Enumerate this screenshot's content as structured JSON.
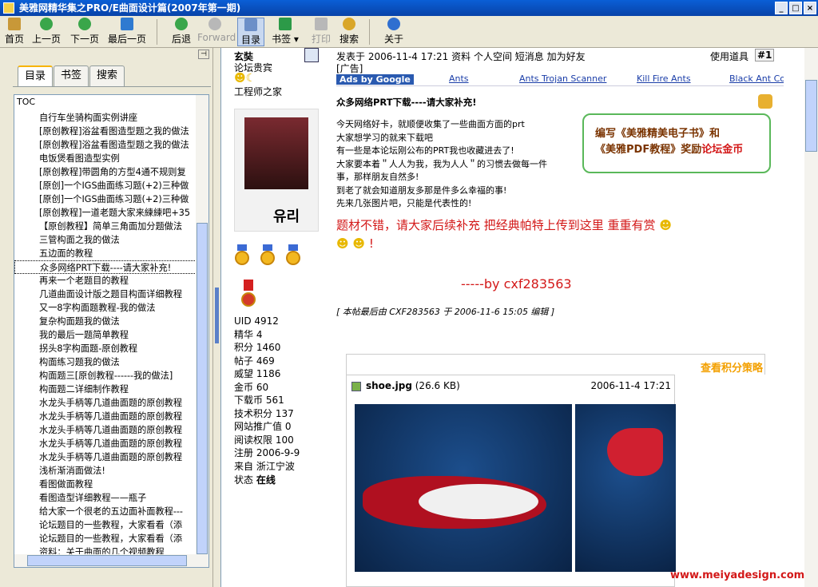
{
  "window": {
    "title": "美雅网精华集之PRO/E曲面设计篇(2007年第一期)"
  },
  "toolbar": {
    "home": "首页",
    "prev": "上一页",
    "next": "下一页",
    "last": "最后一页",
    "back": "后退",
    "forward": "Forward",
    "toc": "目录",
    "bookmark": "书签",
    "print": "打印",
    "search": "搜索",
    "about": "关于"
  },
  "left": {
    "tabs": [
      "目录",
      "书签",
      "搜索"
    ],
    "toc_header": "TOC",
    "items": [
      "自行车坐骑构面实例讲座",
      "[原创教程]浴盆看图造型题之我的做法",
      "[原创教程]浴盆看图造型题之我的做法",
      "电饭煲看图造型实例",
      "[原创教程]带圆角的方型4通不规则复",
      "[原创]一个IGS曲面练习题(+2)三种做",
      "[原创]一个IGS曲面练习题(+2)三种做",
      "[原创教程]一道老题大家来練練吧+35",
      "【原创教程】简单三角面加分题做法",
      "三管构面之我的做法",
      "五边面的教程",
      "众多网络PRT下载----请大家补充!",
      "再来一个老题目的教程",
      "几道曲面设计版之题目构面详细教程",
      "又一8字构面题教程-我的做法",
      "复杂构面题我的做法",
      "我的最后一题简单教程",
      "拐头8字构面题-原创教程",
      "构面练习题我的做法",
      "构面题三[原创教程------我的做法]",
      "构面题二详细制作教程",
      "水龙头手柄等几道曲面题的原创教程",
      "水龙头手柄等几道曲面题的原创教程",
      "水龙头手柄等几道曲面题的原创教程",
      "水龙头手柄等几道曲面题的原创教程",
      "水龙头手柄等几道曲面题的原创教程",
      "浅析渐消面做法!",
      "看图做面教程",
      "看图造型详细教程——瓶子",
      "给大家一个很老的五边面补面教程---",
      "论坛题目的一些教程，大家看看（添",
      "论坛题目的一些教程，大家看看（添",
      "资料：关于曲面的几个视频教程"
    ]
  },
  "post": {
    "author": "玄奘",
    "rank": "论坛贵宾",
    "title2": "工程师之家",
    "meta": "发表于 2006-11-4 17:21  资料  个人空间  短消息  加为好友",
    "tools": "使用道具",
    "floor": "#1",
    "ad_tag": "[广告]",
    "ads": [
      "Ads by Google",
      "Ants",
      "Ants Trojan Scanner",
      "Kill Fire Ants",
      "Black Ant Con"
    ],
    "heading": "众多网络PRT下载----请大家补充!",
    "body": [
      "今天网络好卡，就顺便收集了一些曲面方面的prt",
      "大家想学习的就来下载吧",
      "有一些是本论坛刚公布的PRT我也收藏进去了!",
      "大家要本着＂人人为我，我为人人＂的习惯去做每一件",
      "事，那样朋友自然多!",
      "到老了就会知道朋友多那是件多么幸福的事!",
      "先来几张图片吧，只能是代表性的!"
    ],
    "promo_line1": "编写《美雅精美电子书》和",
    "promo_line2a": "《美雅PDF教程》奖励",
    "promo_line2b": "论坛金币",
    "red_line1": "题材不错，请大家后续补充 把经典帕特上传到这里  重重有赏",
    "red_line2": "!",
    "byline": "-----by  cxf283563",
    "edit_note": "[ 本帖最后由 CXF283563 于 2006-11-6 15:05 编辑 ]",
    "stats": [
      "UID 4912",
      "精华 4",
      "积分 1460",
      "帖子 469",
      "威望 1186",
      "金币 60",
      "下载币 561",
      "技术积分 137",
      "网站推广值 0",
      "阅读权限 100",
      "注册 2006-9-9",
      "来自 浙江宁波"
    ],
    "status_label": "状态",
    "status_value": "在线",
    "points_link": "查看积分策略",
    "attachment": {
      "name": "shoe.jpg",
      "size": "(26.6 KB)",
      "date": "2006-11-4 17:21"
    },
    "watermark": "www.meiyadesign.com",
    "avatar_text": "유리"
  }
}
